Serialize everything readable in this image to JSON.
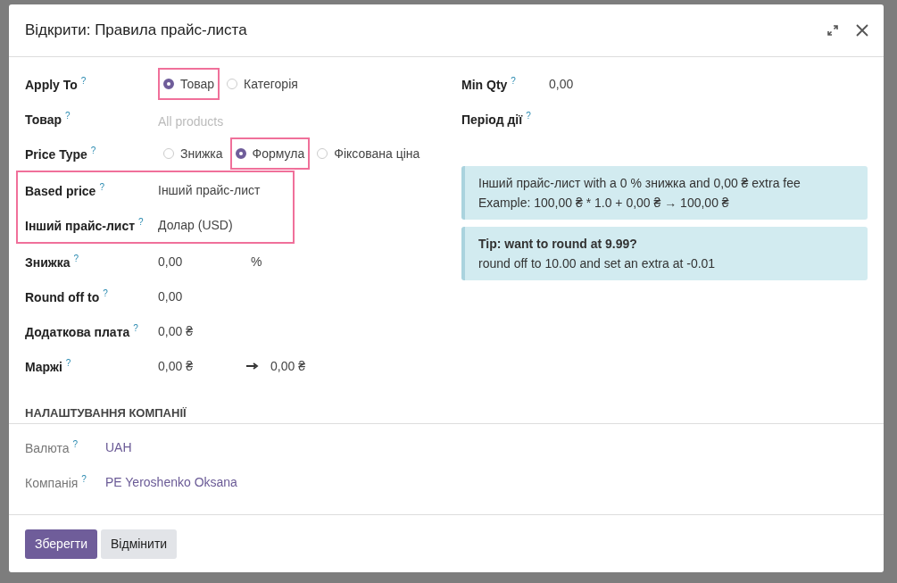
{
  "dialog": {
    "title": "Відкрити: Правила прайс-листа"
  },
  "apply_to": {
    "label": "Apply To",
    "help": "?",
    "options": [
      {
        "label": "Товар",
        "selected": true,
        "highlighted": true
      },
      {
        "label": "Категорія",
        "selected": false,
        "highlighted": false
      }
    ]
  },
  "product": {
    "label": "Товар",
    "help": "?",
    "placeholder": "All products"
  },
  "price_type": {
    "label": "Price Type",
    "help": "?",
    "options": [
      {
        "label": "Знижка",
        "selected": false,
        "highlighted": false
      },
      {
        "label": "Формула",
        "selected": true,
        "highlighted": true
      },
      {
        "label": "Фіксована ціна",
        "selected": false,
        "highlighted": false
      }
    ]
  },
  "formula_group": {
    "highlighted": true,
    "rows": [
      {
        "label": "Based price",
        "help": "?",
        "value": "Інший прайс-лист"
      },
      {
        "label": "Інший прайс-лист",
        "help": "?",
        "value": "Долар (USD)"
      }
    ]
  },
  "fields": [
    {
      "kind": "suffix",
      "label": "Знижка",
      "help": "?",
      "value": "0,00",
      "suffix": "%"
    },
    {
      "kind": "plain",
      "label": "Round off to",
      "help": "?",
      "value": "0,00"
    },
    {
      "kind": "plain",
      "label": "Додаткова плата",
      "help": "?",
      "value": "0,00 ₴"
    },
    {
      "kind": "range",
      "label": "Маржі",
      "help": "?",
      "value": "0,00 ₴",
      "value_2": "0,00 ₴"
    }
  ],
  "right_fields": [
    {
      "label": "Min Qty",
      "help": "?",
      "value": "0,00"
    },
    {
      "label": "Період дії",
      "help": "?"
    }
  ],
  "info_box": {
    "lines": [
      "Інший прайс-лист with a 0 % знижка and 0,00 ₴ extra fee",
      "Example: 100,00 ₴ * 1.0 + 0,00 ₴ → 100,00 ₴"
    ]
  },
  "tip_box": {
    "title": "Tip: want to round at 9.99?",
    "text": "round off to 10.00 and set an extra at -0.01"
  },
  "company_section": {
    "heading": "НАЛАШТУВАННЯ КОМПАНІЇ",
    "fields": [
      {
        "label": "Валюта",
        "help": "?",
        "value": "UAH"
      },
      {
        "label": "Компанія",
        "help": "?",
        "value": "PE Yeroshenko Oksana"
      }
    ]
  },
  "buttons": [
    {
      "label": "Зберегти",
      "kind": "primary"
    },
    {
      "label": "Відмінити",
      "kind": "secondary"
    }
  ]
}
